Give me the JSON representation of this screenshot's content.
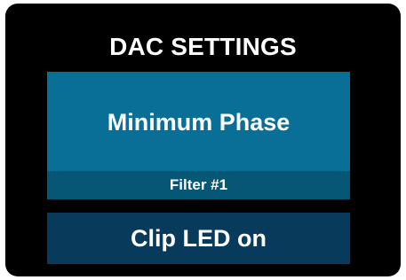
{
  "screen": {
    "title": "DAC SETTINGS",
    "filter": {
      "value": "Minimum Phase",
      "label": "Filter #1"
    },
    "clip_led": {
      "label": "Clip LED on"
    }
  },
  "colors": {
    "background": "#000000",
    "filter_card": "#0a6f96",
    "filter_label_bar": "#065776",
    "clip_button": "#083a5c",
    "text": "#ffffff"
  }
}
